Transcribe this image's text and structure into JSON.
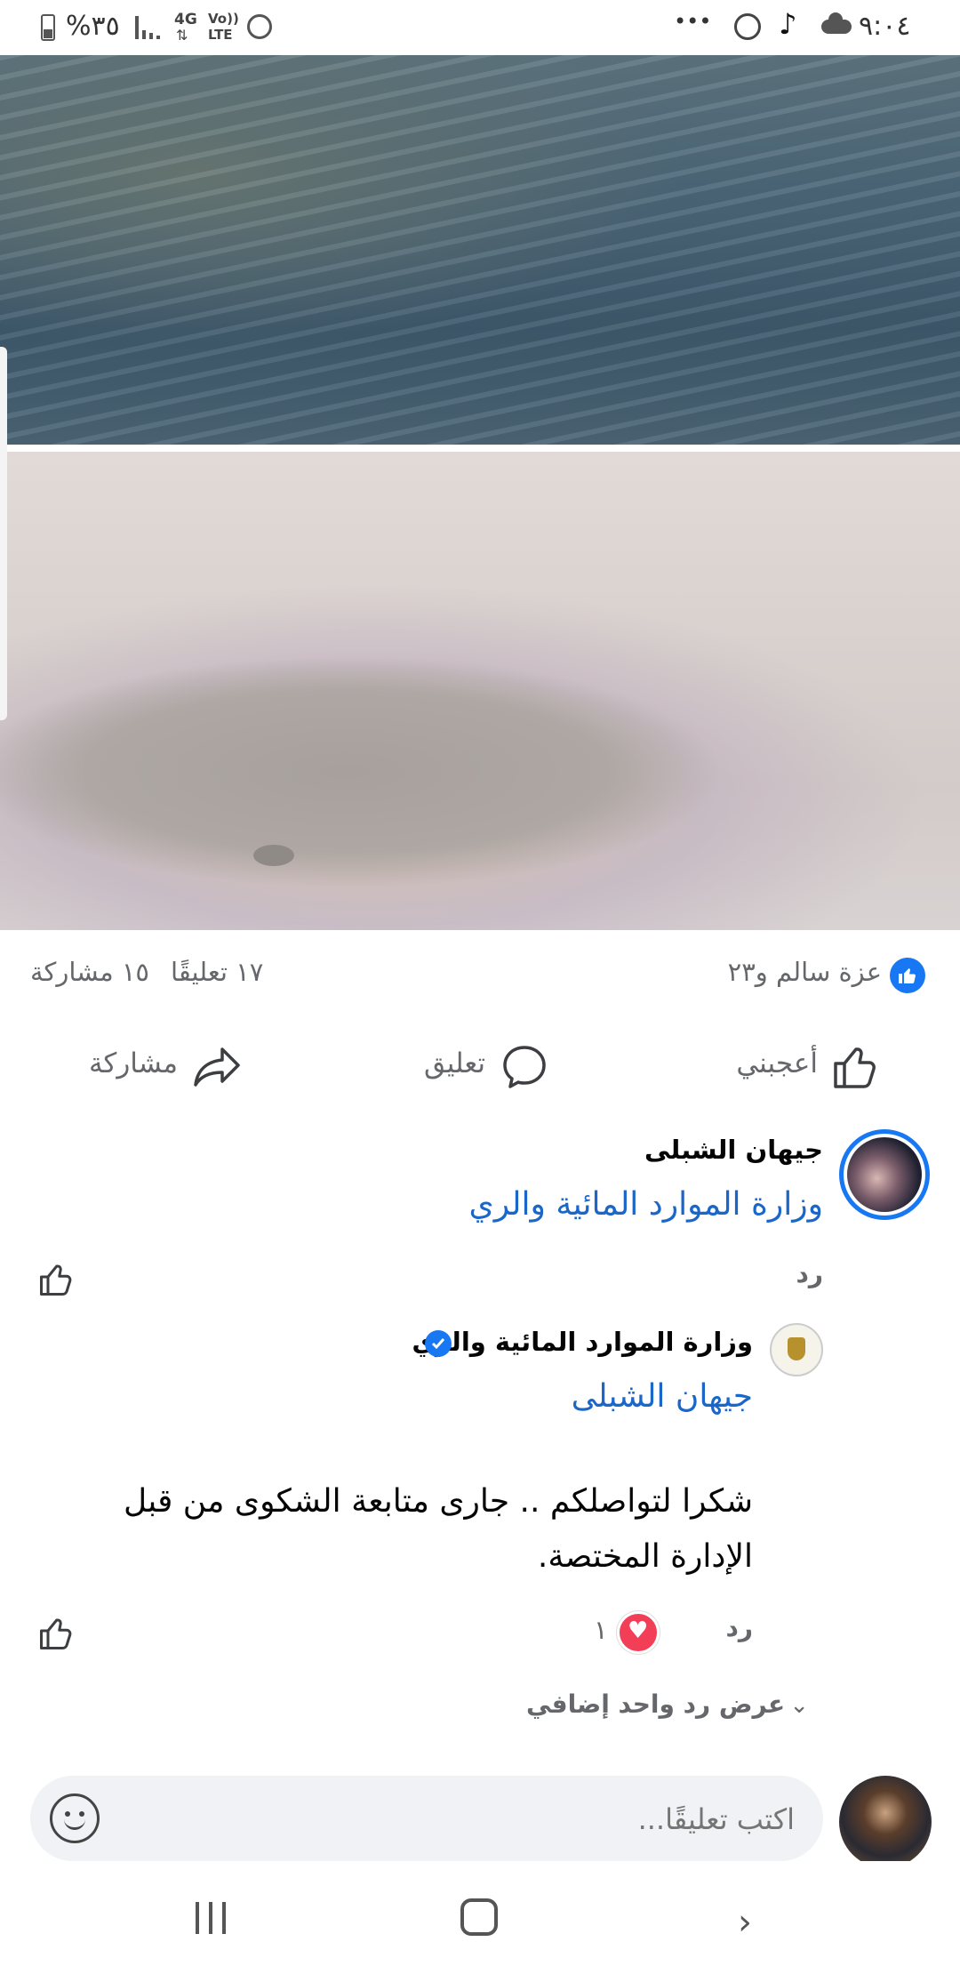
{
  "status_bar": {
    "time": "٩:٠٤",
    "more": "•••",
    "battery": "%٣٥",
    "network_4g": "4G",
    "volte": "Vo)) LTE"
  },
  "post": {
    "reactions_summary": "عزة سالم و٢٣",
    "comments_count": "١٧ تعليقًا",
    "shares_count": "١٥ مشاركة",
    "actions": {
      "like": "أعجبني",
      "comment": "تعليق",
      "share": "مشاركة"
    }
  },
  "comments": [
    {
      "author": "جيهان الشبلى",
      "mention": "وزارة الموارد المائية والري",
      "reply_label": "رد"
    },
    {
      "author": "وزارة الموارد المائية والري",
      "verified": true,
      "mention": "جيهان الشبلى",
      "text_line1": "شكرا لتواصلكم .. جارى متابعة الشكوى من قبل",
      "text_line2": "الإدارة المختصة.",
      "reply_label": "رد",
      "reaction_count": "١"
    }
  ],
  "more_replies": "عرض رد واحد إضافي",
  "composer": {
    "placeholder": "اكتب تعليقًا..."
  },
  "colors": {
    "facebook_blue": "#1877f2",
    "mention_blue": "#1b66c9",
    "secondary_text": "#65676b",
    "love_red": "#f33e58"
  }
}
